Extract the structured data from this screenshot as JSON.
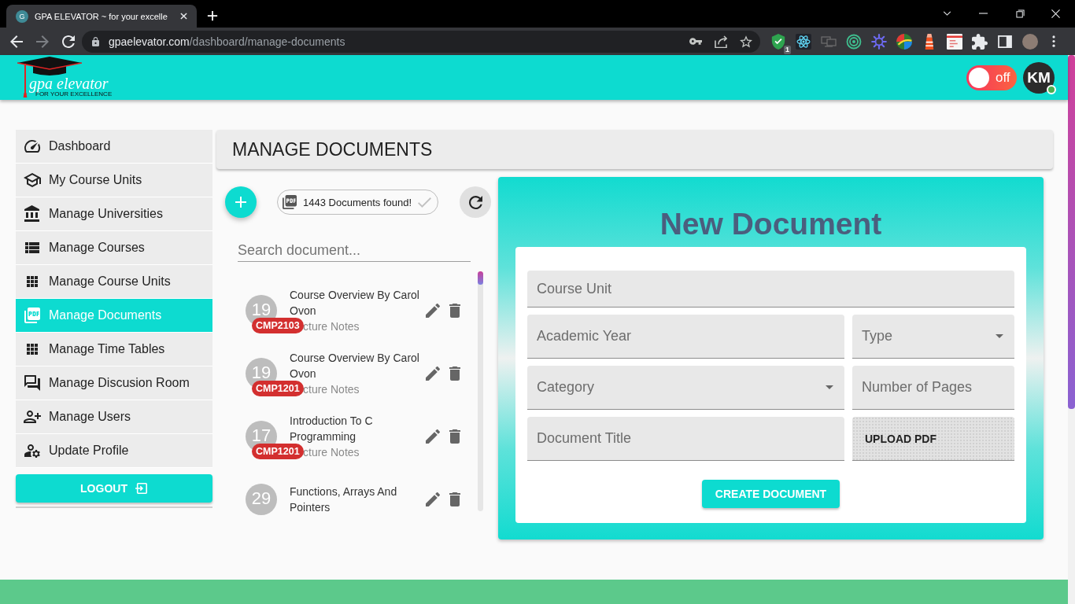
{
  "browser": {
    "tab": {
      "favicon": "G",
      "title": "GPA ELEVATOR ~ for your excelle"
    },
    "forward_disabled": true,
    "address": {
      "host": "gpaelevator.com",
      "path": "/dashboard/manage-documents"
    },
    "extension_badge": "1"
  },
  "header": {
    "logo": {
      "name": "gpa elevator",
      "tagline": "FOR YOUR EXCELLENCE"
    },
    "toggle": {
      "label": "off",
      "on": false
    },
    "user": {
      "initials": "KM",
      "online": true
    }
  },
  "sidebar": {
    "items": [
      {
        "label": "Dashboard",
        "selected": false
      },
      {
        "label": "My Course Units",
        "selected": false
      },
      {
        "label": "Manage Universities",
        "selected": false
      },
      {
        "label": "Manage Courses",
        "selected": false
      },
      {
        "label": "Manage Course Units",
        "selected": false
      },
      {
        "label": "Manage Documents",
        "selected": true
      },
      {
        "label": "Manage Time Tables",
        "selected": false
      },
      {
        "label": "Manage Discusion Room",
        "selected": false
      },
      {
        "label": "Manage Users",
        "selected": false
      },
      {
        "label": "Update Profile",
        "selected": false
      }
    ],
    "logout": "LOGOUT"
  },
  "page_title": "MANAGE DOCUMENTS",
  "documents": {
    "count": "1443 Documents found!",
    "search": {
      "placeholder": "Search document..."
    },
    "items": [
      {
        "count": "19",
        "title": "Course Overview By Carol Ovon",
        "code": "CMP2103",
        "category": "cture Notes"
      },
      {
        "count": "19",
        "title": "Course Overview By Carol Ovon",
        "code": "CMP1201",
        "category": "cture Notes"
      },
      {
        "count": "17",
        "title": "Introduction To C Programming",
        "code": "CMP1201",
        "category": "cture Notes"
      },
      {
        "count": "29",
        "title": "Functions, Arrays And Pointers"
      }
    ]
  },
  "form": {
    "title": "New Document",
    "fields": [
      {
        "kind": "text",
        "placeholder": "Course Unit"
      },
      {
        "kind": "text",
        "placeholder": "Academic Year"
      },
      {
        "kind": "select",
        "label": "Type"
      },
      {
        "kind": "select",
        "label": "Category"
      },
      {
        "kind": "text",
        "placeholder": "Number of Pages"
      },
      {
        "kind": "text",
        "placeholder": "Document Title"
      },
      {
        "kind": "upload",
        "label": "UPLOAD PDF"
      }
    ],
    "submit": "CREATE DOCUMENT"
  }
}
